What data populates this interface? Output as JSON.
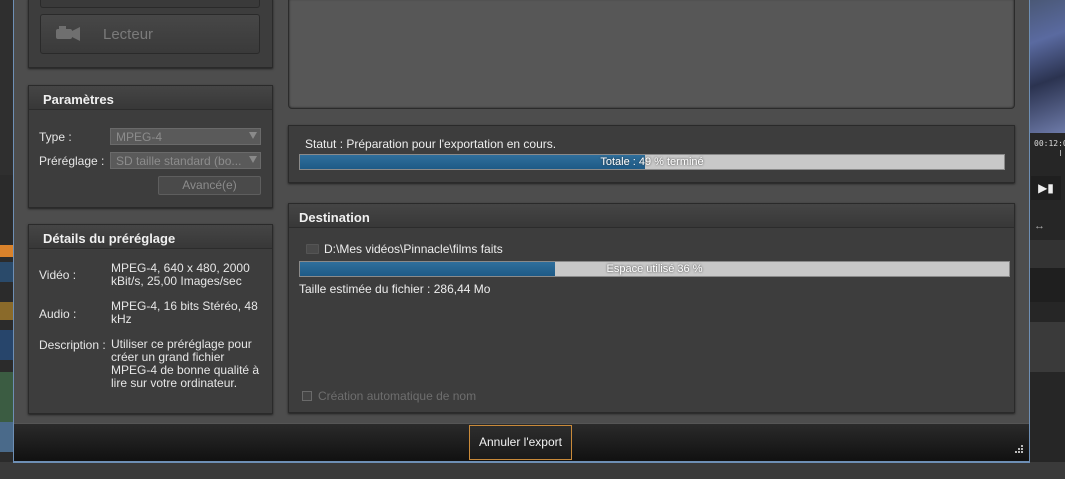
{
  "left_column": {
    "lecteur_button": {
      "label": "Lecteur",
      "icon": "camcorder-icon"
    },
    "parametres": {
      "title": "Paramètres",
      "type_label": "Type :",
      "type_value": "MPEG-4",
      "preset_label": "Préréglage :",
      "preset_value": "SD taille standard (bo...",
      "advanced_label": "Avancé(e)"
    },
    "details": {
      "title": "Détails du préréglage",
      "video_label": "Vidéo :",
      "video_value": "MPEG-4, 640 x 480, 2000 kBit/s, 25,00 Images/sec",
      "audio_label": "Audio :",
      "audio_value": "MPEG-4, 16 bits Stéréo, 48 kHz",
      "description_label": "Description :",
      "description_value": "Utiliser ce préréglage pour créer un grand fichier MPEG-4 de bonne qualité à lire sur votre ordinateur."
    }
  },
  "status": {
    "text": "Statut : Préparation pour l'exportation en cours.",
    "progress_label": "Totale : 49 % terminé",
    "progress_fraction": 0.49
  },
  "destination": {
    "title": "Destination",
    "folder_icon": "folder-icon",
    "path": "D:\\Mes vidéos\\Pinnacle\\films faits",
    "space_label": "Espace utilisé 36 %",
    "space_fraction": 0.36,
    "estimated_size": "Taille estimée du fichier : 286,44 Mo",
    "auto_name_label": "Création automatique de nom",
    "auto_name_checked": false
  },
  "footer": {
    "cancel_label": "Annuler l'export"
  },
  "background_app": {
    "timecode": "00:12:0"
  },
  "colors": {
    "progress_fill": "#1e5a86",
    "cancel_border": "#c98a3a",
    "dialog_border": "#6e8fb5"
  }
}
